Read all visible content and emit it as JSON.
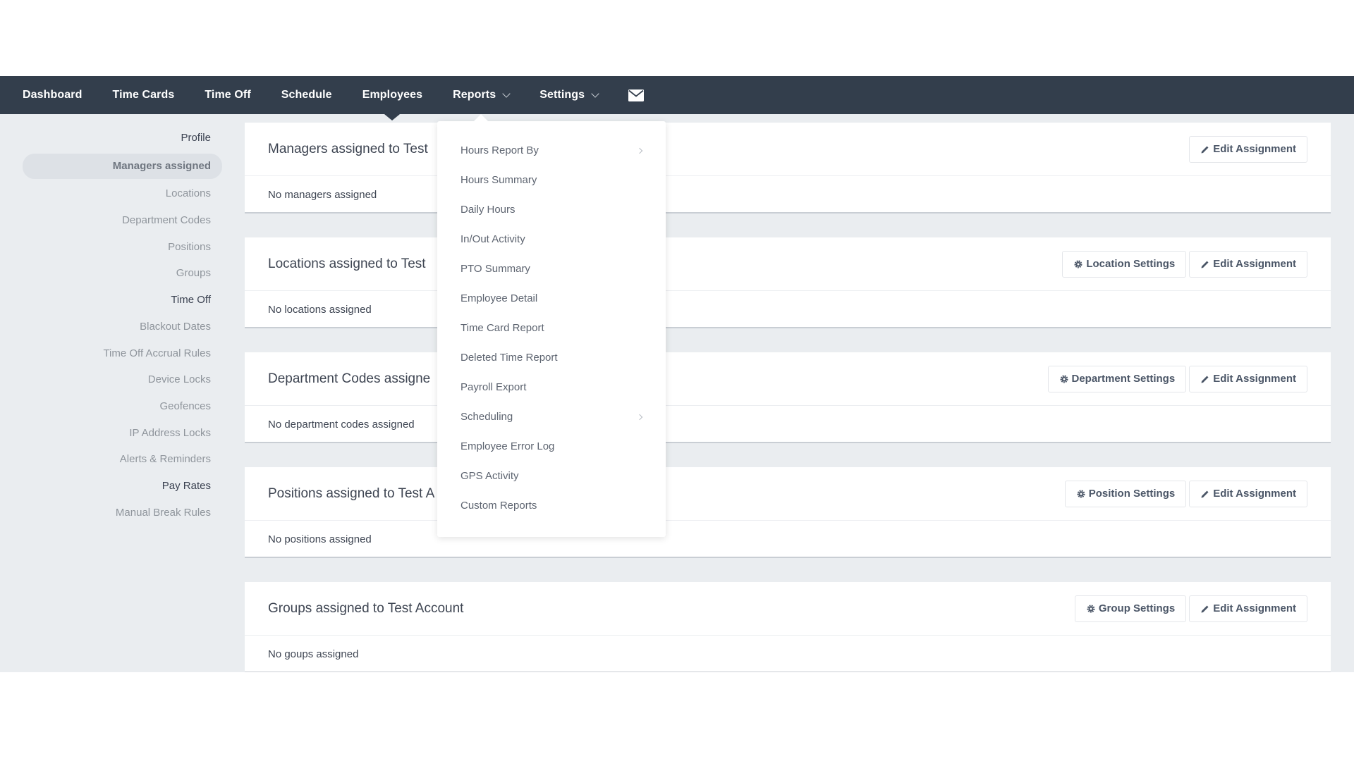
{
  "nav": {
    "items": [
      {
        "label": "Dashboard"
      },
      {
        "label": "Time Cards"
      },
      {
        "label": "Time Off"
      },
      {
        "label": "Schedule"
      },
      {
        "label": "Employees"
      },
      {
        "label": "Reports"
      },
      {
        "label": "Settings"
      }
    ],
    "mail_icon": "envelope-icon"
  },
  "sidebar": {
    "items": [
      {
        "label": "Profile"
      },
      {
        "label": "Managers assigned"
      },
      {
        "label": "Locations"
      },
      {
        "label": "Department Codes"
      },
      {
        "label": "Positions"
      },
      {
        "label": "Groups"
      },
      {
        "label": "Time Off"
      },
      {
        "label": "Blackout Dates"
      },
      {
        "label": "Time Off Accrual Rules"
      },
      {
        "label": "Device Locks"
      },
      {
        "label": "Geofences"
      },
      {
        "label": "IP Address Locks"
      },
      {
        "label": "Alerts & Reminders"
      },
      {
        "label": "Pay Rates"
      },
      {
        "label": "Manual Break Rules"
      }
    ]
  },
  "panels": [
    {
      "title": "Managers assigned to Test",
      "empty": "No managers assigned",
      "edit_label": "Edit Assignment"
    },
    {
      "title": "Locations assigned to Test",
      "empty": "No locations assigned",
      "settings_label": "Location Settings",
      "edit_label": "Edit Assignment"
    },
    {
      "title": "Department Codes assigne",
      "empty": "No department codes assigned",
      "settings_label": "Department Settings",
      "edit_label": "Edit Assignment"
    },
    {
      "title": "Positions assigned to Test A",
      "empty": "No positions assigned",
      "settings_label": "Position Settings",
      "edit_label": "Edit Assignment"
    },
    {
      "title": "Groups assigned to Test Account",
      "empty": "No goups assigned",
      "settings_label": "Group Settings",
      "edit_label": "Edit Assignment"
    }
  ],
  "reports_menu": {
    "items": [
      {
        "label": "Hours Report By"
      },
      {
        "label": "Hours Summary"
      },
      {
        "label": "Daily Hours"
      },
      {
        "label": "In/Out Activity"
      },
      {
        "label": "PTO Summary"
      },
      {
        "label": "Employee Detail"
      },
      {
        "label": "Time Card Report"
      },
      {
        "label": "Deleted Time Report"
      },
      {
        "label": "Payroll Export"
      },
      {
        "label": "Scheduling"
      },
      {
        "label": "Employee Error Log"
      },
      {
        "label": "GPS Activity"
      },
      {
        "label": "Custom Reports"
      }
    ]
  },
  "colors": {
    "nav_bg": "#333e4c",
    "page_bg": "#eaedf0",
    "text": "#3e4552"
  }
}
